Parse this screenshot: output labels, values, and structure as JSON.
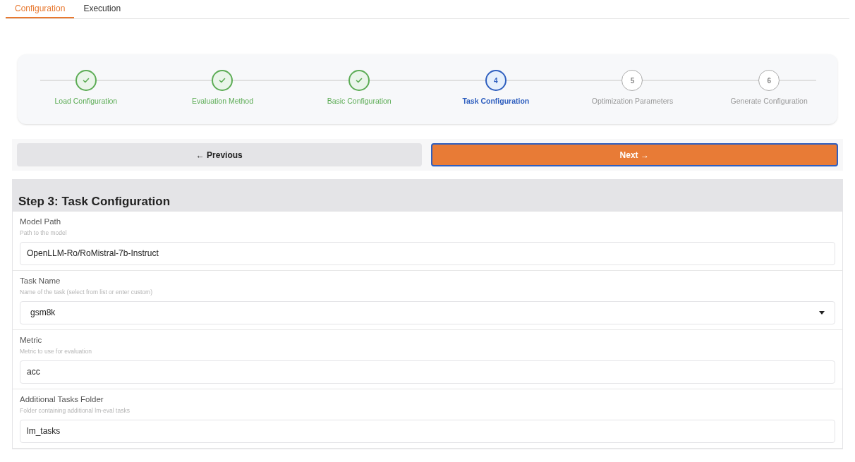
{
  "tabs": [
    {
      "label": "Configuration",
      "selected": true
    },
    {
      "label": "Execution",
      "selected": false
    }
  ],
  "stepper": [
    {
      "label": "Load Configuration",
      "completed": true,
      "selected": false
    },
    {
      "label": "Evaluation Method",
      "completed": true,
      "selected": false
    },
    {
      "label": "Basic Configuration",
      "completed": true,
      "selected": false
    },
    {
      "label": "Task Configuration",
      "completed": false,
      "selected": true,
      "number": "4"
    },
    {
      "label": "Optimization Parameters",
      "completed": false,
      "selected": false,
      "number": "5"
    },
    {
      "label": "Generate Configuration",
      "completed": false,
      "selected": false,
      "number": "6"
    }
  ],
  "navigation": {
    "previous": "← Previous",
    "next": "Next →"
  },
  "form": {
    "title": "Step 3: Task Configuration",
    "fields": [
      {
        "kind": "text",
        "label": "Model Path",
        "hint": "Path to the model",
        "value": "OpenLLM-Ro/RoMistral-7b-Instruct"
      },
      {
        "kind": "select",
        "label": "Task Name",
        "hint": "Name of the task (select from list or enter custom)",
        "value": "gsm8k"
      },
      {
        "kind": "text",
        "label": "Metric",
        "hint": "Metric to use for evaluation",
        "value": "acc"
      },
      {
        "kind": "text",
        "label": "Additional Tasks Folder",
        "hint": "Folder containing additional lm-eval tasks",
        "value": "lm_tasks"
      }
    ]
  }
}
